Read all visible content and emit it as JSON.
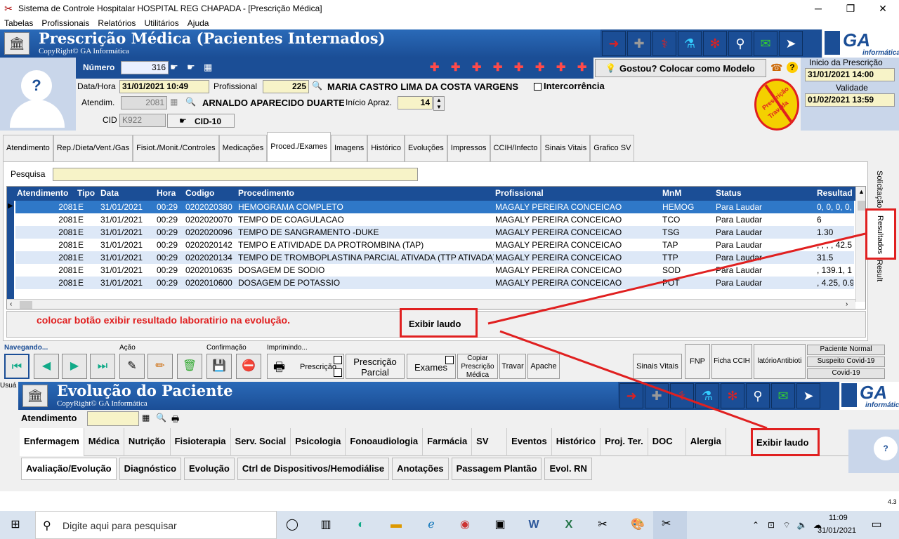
{
  "window": {
    "title": "Sistema de Controle Hospitalar HOSPITAL REG CHAPADA - [Prescrição Médica]",
    "minimize": "─",
    "maximize": "❐",
    "close": "✕"
  },
  "menu": [
    "Tabelas",
    "Profissionais",
    "Relatórios",
    "Utilitários",
    "Ajuda"
  ],
  "header": {
    "title": "Prescrição Médica (Pacientes Internados)",
    "copyright": "CopyRight© GA Informática",
    "ga_logo": "GA",
    "ga_sub": "informática"
  },
  "form": {
    "numero_label": "Número",
    "numero": "316",
    "modelo_btn": "Gostou? Colocar como Modelo",
    "inicio_label": "Inicio da Prescrição",
    "inicio": "31/01/2021 14:00",
    "validade_label": "Validade",
    "validade": "01/02/2021 13:59",
    "datahora_label": "Data/Hora",
    "datahora": "31/01/2021 10:49",
    "profissional_label": "Profissional",
    "profissional_cod": "225",
    "profissional_nome": "MARIA CASTRO LIMA DA COSTA VARGENS",
    "intercorrencia": "Intercorrência",
    "atendim_label": "Atendim.",
    "atendim": "2081",
    "paciente": "ARNALDO APARECIDO DUARTE",
    "inicio_apraz_label": "Início Apraz.",
    "inicio_apraz": "14",
    "cid_label": "CID",
    "cid": "K922",
    "cid10_btn": "CID-10",
    "stamp_line1": "Prescrição",
    "stamp_line2": "Travada"
  },
  "tabs": [
    "Atendimento",
    "Rep./Dieta/Vent./Gas",
    "Fisiot./Monit./Controles",
    "Medicações",
    "Proced./Exames",
    "Imagens",
    "Histórico",
    "Evoluções",
    "Impressos",
    "CCIH/Infecto",
    "Sinais Vitais",
    "Grafico SV"
  ],
  "pesquisa_label": "Pesquisa",
  "grid": {
    "headers": [
      "Atendimento",
      "Tipo",
      "Data",
      "Hora",
      "Codigo",
      "Procedimento",
      "Profissional",
      "MnM",
      "Status",
      "Resultad"
    ],
    "rows": [
      [
        "2081",
        "E",
        "31/01/2021",
        "00:29",
        "0202020380",
        "HEMOGRAMA COMPLETO",
        "MAGALY PEREIRA CONCEICAO",
        "HEMOG",
        "Para Laudar",
        "0, 0, 0, 0,"
      ],
      [
        "2081",
        "E",
        "31/01/2021",
        "00:29",
        "0202020070",
        "TEMPO DE COAGULACAO",
        "MAGALY PEREIRA CONCEICAO",
        "TCO",
        "Para Laudar",
        "6"
      ],
      [
        "2081",
        "E",
        "31/01/2021",
        "00:29",
        "0202020096",
        "TEMPO DE SANGRAMENTO -DUKE",
        "MAGALY PEREIRA CONCEICAO",
        "TSG",
        "Para Laudar",
        "1.30"
      ],
      [
        "2081",
        "E",
        "31/01/2021",
        "00:29",
        "0202020142",
        "TEMPO E ATIVIDADE DA PROTROMBINA (TAP)",
        "MAGALY PEREIRA CONCEICAO",
        "TAP",
        "Para Laudar",
        ", , , , 42.5"
      ],
      [
        "2081",
        "E",
        "31/01/2021",
        "00:29",
        "0202020134",
        "TEMPO DE TROMBOPLASTINA PARCIAL ATIVADA (TTP ATIVADA)",
        "MAGALY PEREIRA CONCEICAO",
        "TTP",
        "Para Laudar",
        "31.5"
      ],
      [
        "2081",
        "E",
        "31/01/2021",
        "00:29",
        "0202010635",
        "DOSAGEM DE SODIO",
        "MAGALY PEREIRA CONCEICAO",
        "SOD",
        "Para Laudar",
        ", 139.1, 1"
      ],
      [
        "2081",
        "E",
        "31/01/2021",
        "00:29",
        "0202010600",
        "DOSAGEM DE POTASSIO",
        "MAGALY PEREIRA CONCEICAO",
        "POT",
        "Para Laudar",
        ", 4.25, 0.9"
      ]
    ]
  },
  "side_tabs": [
    "Solicitação",
    "Resultados",
    "Result"
  ],
  "annotation": "colocar botão exibir resultado laboratirio na evolução.",
  "exibir_laudo": "Exibir laudo",
  "bottom": {
    "navegando": "Navegando...",
    "acao": "Ação",
    "confirmacao": "Confirmação",
    "imprimindo": "Imprimindo...",
    "prescricao": "Prescrição",
    "prescricao_parcial": "Prescrição Parcial",
    "exames": "Exames",
    "copiar": "Copiar Prescrição Médica",
    "travar": "Travar",
    "apache": "Apache",
    "sinais_vitais": "Sinais Vitais",
    "fnp": "FNP",
    "ficha_ccih": "Ficha CCIH",
    "relatorio": "latórioAntibioti",
    "paciente_normal": "Paciente Normal",
    "suspeito": "Suspeito Covid-19",
    "covid": "Covid-19",
    "usuario": "Usuá"
  },
  "evolucao": {
    "title": "Evolução do Paciente",
    "copyright": "CopyRight© GA Informática",
    "atendimento_label": "Atendimento",
    "tabs": [
      "Enfermagem",
      "Médica",
      "Nutrição",
      "Fisioterapia",
      "Serv. Social",
      "Psicologia",
      "Fonoaudiologia",
      "Farmácia",
      "SV",
      "Eventos",
      "Histórico",
      "Proj. Ter.",
      "DOC",
      "Alergia"
    ],
    "exibir_laudo": "Exibir laudo",
    "subtabs": [
      "Avaliação/Evolução",
      "Diagnóstico",
      "Evolução",
      "Ctrl de Dispositivos/Hemodiálise",
      "Anotações",
      "Passagem Plantão",
      "Evol. RN"
    ],
    "version": "4.3"
  },
  "taskbar": {
    "search": "Digite aqui para pesquisar",
    "time": "11:09",
    "date": "31/01/2021"
  },
  "colors": {
    "accent": "#1b4e96",
    "highlight": "#e02020",
    "field": "#f7f3c8"
  }
}
